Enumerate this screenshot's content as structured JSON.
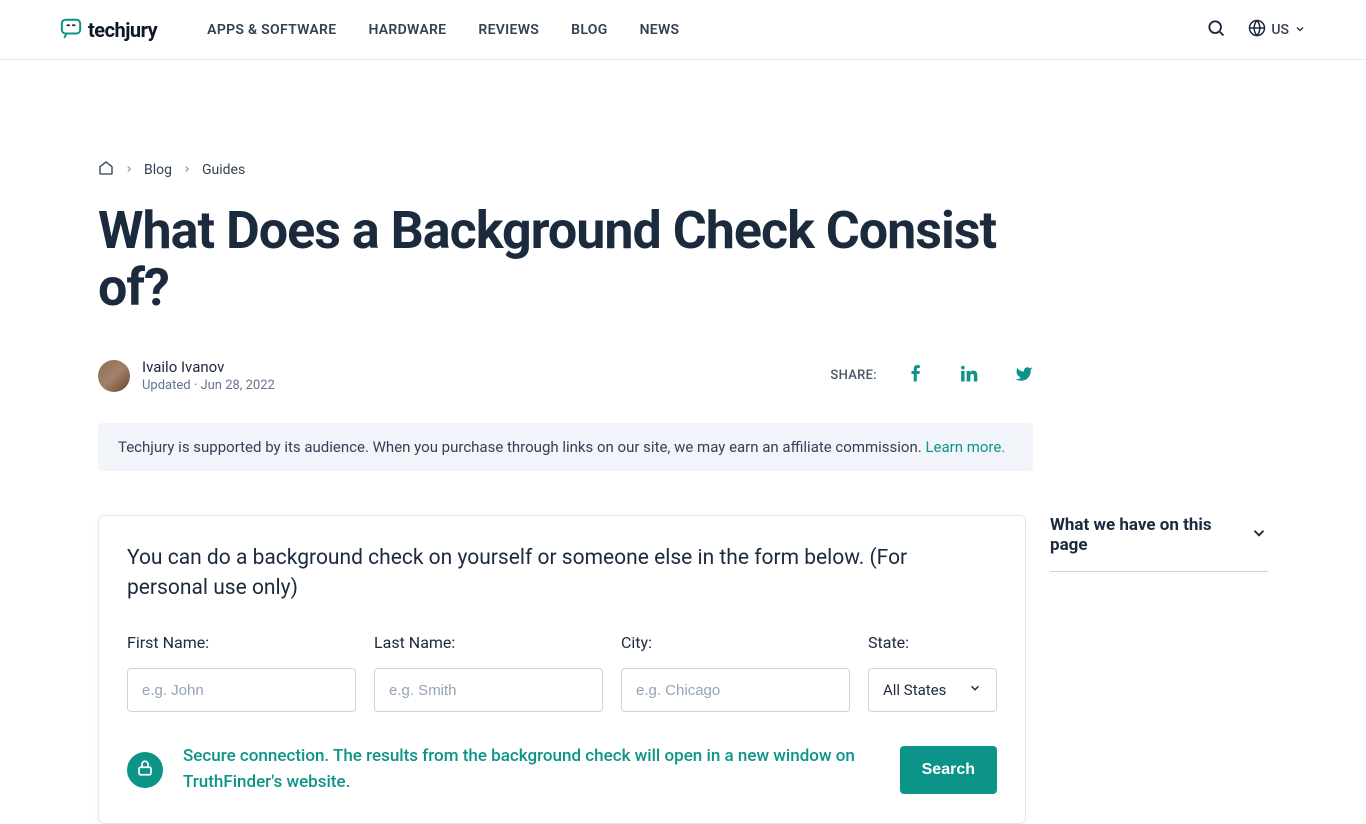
{
  "brand": {
    "name": "techjury"
  },
  "nav": {
    "items": [
      "APPS & SOFTWARE",
      "HARDWARE",
      "REVIEWS",
      "BLOG",
      "NEWS"
    ]
  },
  "locale": "US",
  "breadcrumb": {
    "blog": "Blog",
    "guides": "Guides"
  },
  "page": {
    "title": "What Does a Background Check Consist of?",
    "author": "Ivailo Ivanov",
    "updated": "Updated · Jun 28, 2022",
    "share_label": "SHARE:"
  },
  "notice": {
    "text": "Techjury is supported by its audience. When you purchase through links on our site, we may earn an affiliate commission. ",
    "link": "Learn more."
  },
  "card": {
    "heading": "You can do a background check on yourself or someone else in the form below. (For personal use only)",
    "fields": {
      "first_name_label": "First Name:",
      "first_name_placeholder": "e.g. John",
      "last_name_label": "Last Name:",
      "last_name_placeholder": "e.g. Smith",
      "city_label": "City:",
      "city_placeholder": "e.g. Chicago",
      "state_label": "State:",
      "state_value": "All States"
    },
    "secure_text": "Secure connection. The results from the background check will open in a new window on TruthFinder's website.",
    "search_label": "Search"
  },
  "toc": {
    "title": "What we have on this page"
  }
}
